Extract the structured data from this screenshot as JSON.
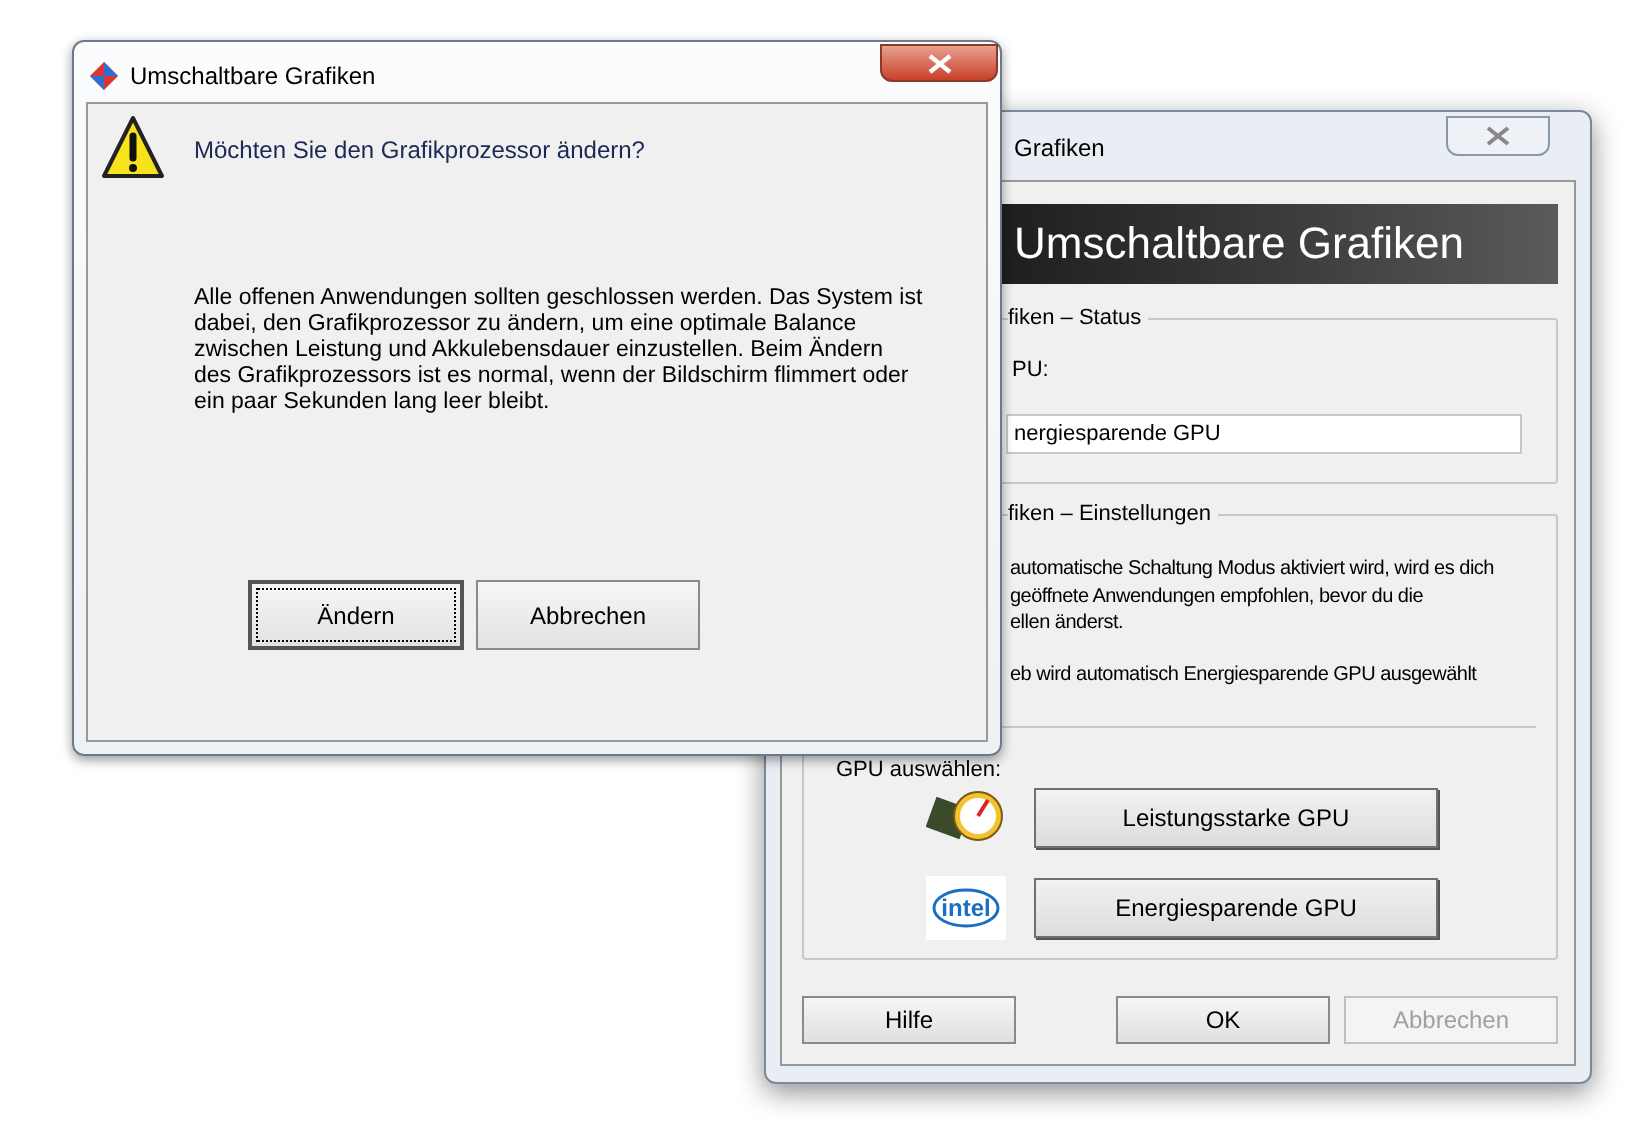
{
  "main_window": {
    "title": "Grafiken",
    "banner": "Umschaltbare Grafiken",
    "status_group": {
      "legend": "fiken – Status",
      "label": "PU:",
      "value": "nergiesparende GPU"
    },
    "settings_group": {
      "legend": "fiken – Einstellungen",
      "lines": [
        "automatische Schaltung Modus aktiviert wird, wird es dich",
        "geöffnete Anwendungen empfohlen, bevor du die",
        "ellen änderst."
      ],
      "note": "eb wird automatisch Energiesparende GPU ausgewählt",
      "select_label": "GPU auswählen:",
      "gpu_buttons": [
        {
          "label": "Leistungsstarke GPU",
          "kind": "gauge"
        },
        {
          "label": "Energiesparende GPU",
          "kind": "intel",
          "logo_text": "intel"
        }
      ]
    },
    "buttons": [
      {
        "label": "Hilfe",
        "disabled": false
      },
      {
        "label": "OK",
        "disabled": false
      },
      {
        "label": "Abbrechen",
        "disabled": true
      }
    ]
  },
  "dialog": {
    "title": "Umschaltbare Grafiken",
    "question": "Möchten Sie den Grafikprozessor ändern?",
    "message": "Alle offenen Anwendungen sollten geschlossen werden. Das System ist\ndabei, den Grafikprozessor zu ändern, um eine optimale Balance\nzwischen Leistung und Akkulebensdauer einzustellen. Beim Ändern\ndes Grafikprozessors ist es normal, wenn der Bildschirm flimmert oder\nein paar Sekunden lang leer bleibt.",
    "buttons": [
      {
        "label": "Ändern",
        "focused": true
      },
      {
        "label": "Abbrechen",
        "focused": false
      }
    ]
  }
}
